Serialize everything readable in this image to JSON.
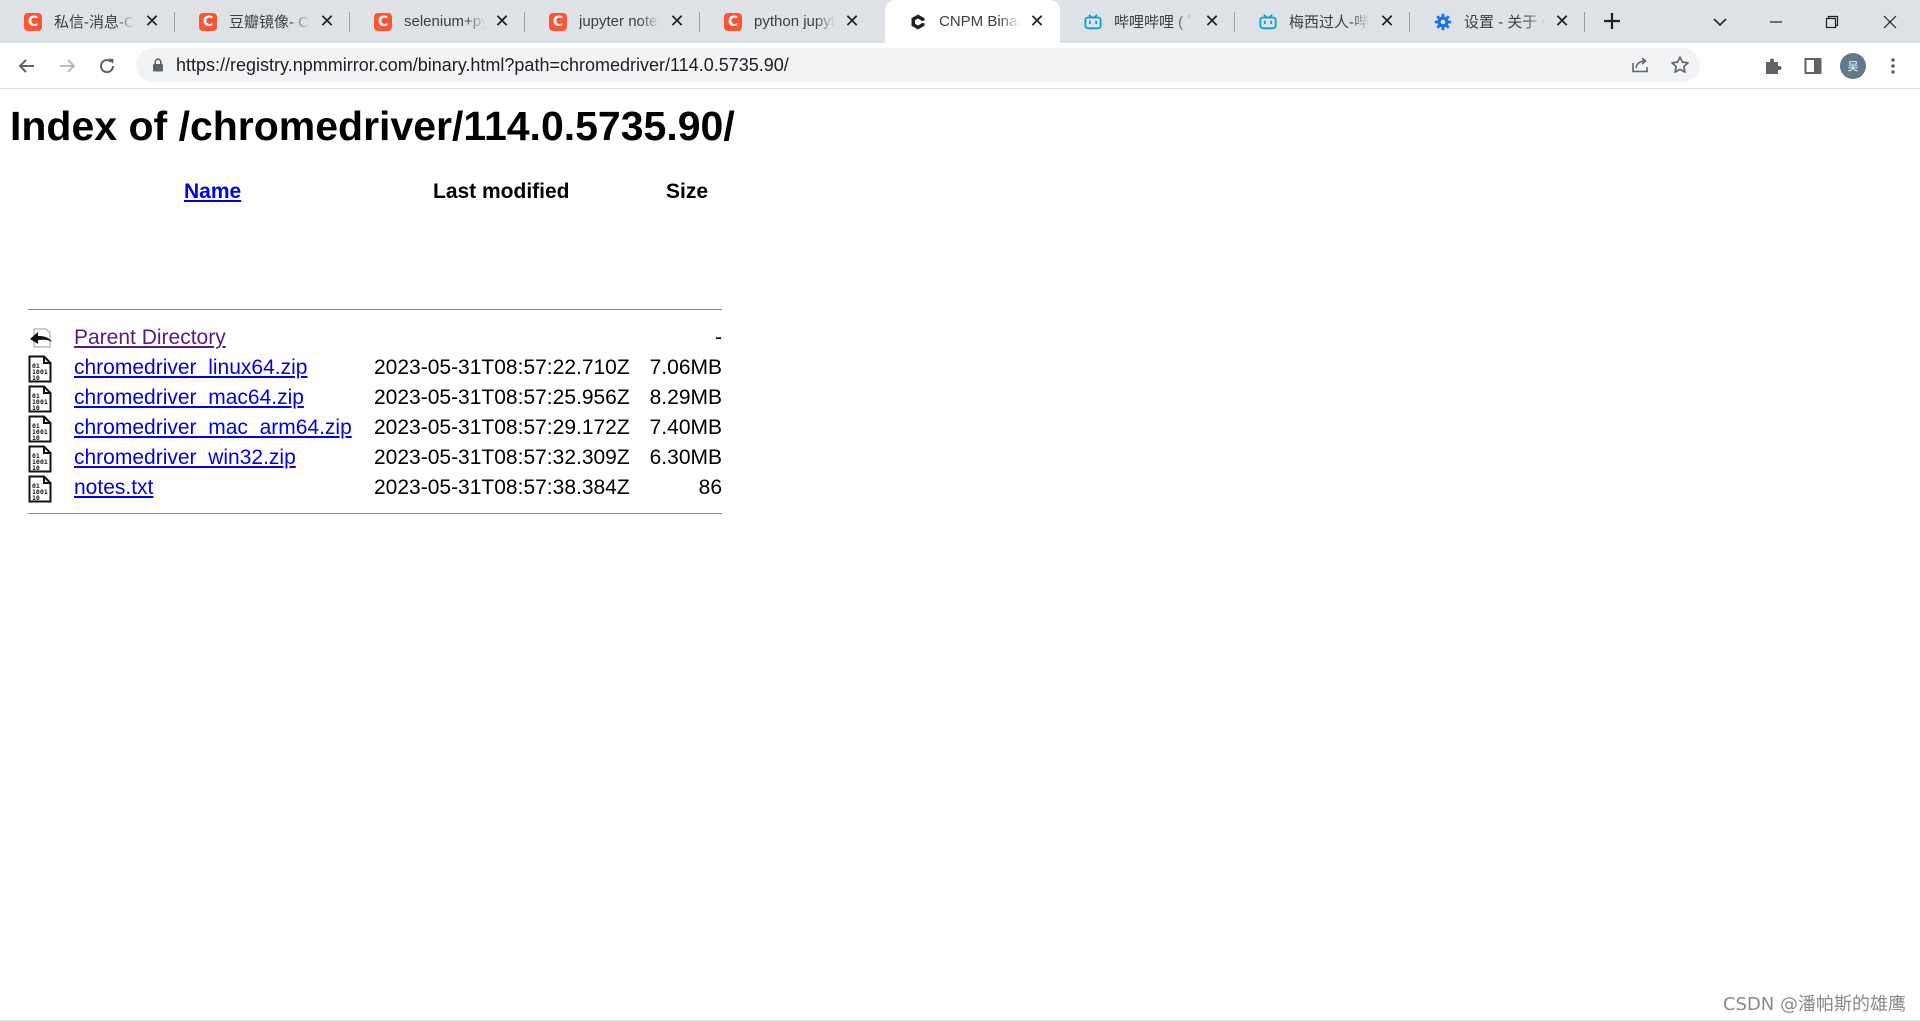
{
  "tabs": [
    {
      "title": "私信-消息-CSDN",
      "favicon": "csdn-icon",
      "active": false
    },
    {
      "title": "豆瓣镜像- CSDN",
      "favicon": "csdn-icon",
      "active": false
    },
    {
      "title": "selenium+python",
      "favicon": "csdn-icon",
      "active": false
    },
    {
      "title": "jupyter notebook",
      "favicon": "csdn-icon",
      "active": false
    },
    {
      "title": "python jupyter",
      "favicon": "csdn-icon",
      "active": false
    },
    {
      "title": "CNPM Binaries",
      "favicon": "cnpm-icon",
      "active": true
    },
    {
      "title": "哔哩哔哩 ( ゜- ゜)",
      "favicon": "bilibili-icon",
      "active": false
    },
    {
      "title": "梅西过人-哔哩哔哩",
      "favicon": "bilibili-icon",
      "active": false
    },
    {
      "title": "设置 - 关于 Chrome",
      "favicon": "settings-gear-icon",
      "active": false
    }
  ],
  "toolbar": {
    "url": "https://registry.npmmirror.com/binary.html?path=chromedriver/114.0.5735.90/",
    "avatar_initial": "吴"
  },
  "page": {
    "title": "Index of /chromedriver/114.0.5735.90/",
    "columns": {
      "name": "Name",
      "last_modified": "Last modified",
      "size": "Size"
    },
    "rows": [
      {
        "name": "Parent Directory",
        "modified": "",
        "size": "-",
        "icon": "parent-directory-icon",
        "visited": true
      },
      {
        "name": "chromedriver_linux64.zip",
        "modified": "2023-05-31T08:57:22.710Z",
        "size": "7.06MB",
        "icon": "file-icon",
        "visited": false
      },
      {
        "name": "chromedriver_mac64.zip",
        "modified": "2023-05-31T08:57:25.956Z",
        "size": "8.29MB",
        "icon": "file-icon",
        "visited": false
      },
      {
        "name": "chromedriver_mac_arm64.zip",
        "modified": "2023-05-31T08:57:29.172Z",
        "size": "7.40MB",
        "icon": "file-icon",
        "visited": false
      },
      {
        "name": "chromedriver_win32.zip",
        "modified": "2023-05-31T08:57:32.309Z",
        "size": "6.30MB",
        "icon": "file-icon",
        "visited": false
      },
      {
        "name": "notes.txt",
        "modified": "2023-05-31T08:57:38.384Z",
        "size": "86",
        "icon": "file-icon",
        "visited": false
      }
    ]
  },
  "watermark": "CSDN @潘帕斯的雄鹰",
  "colors": {
    "link": "#0000ee",
    "visited_link": "#551a8b",
    "tabstrip_bg": "#dee1e6",
    "csdn_brand": "#fc5531",
    "bilibili_brand": "#00a1d6",
    "settings_blue": "#1a73e8"
  }
}
